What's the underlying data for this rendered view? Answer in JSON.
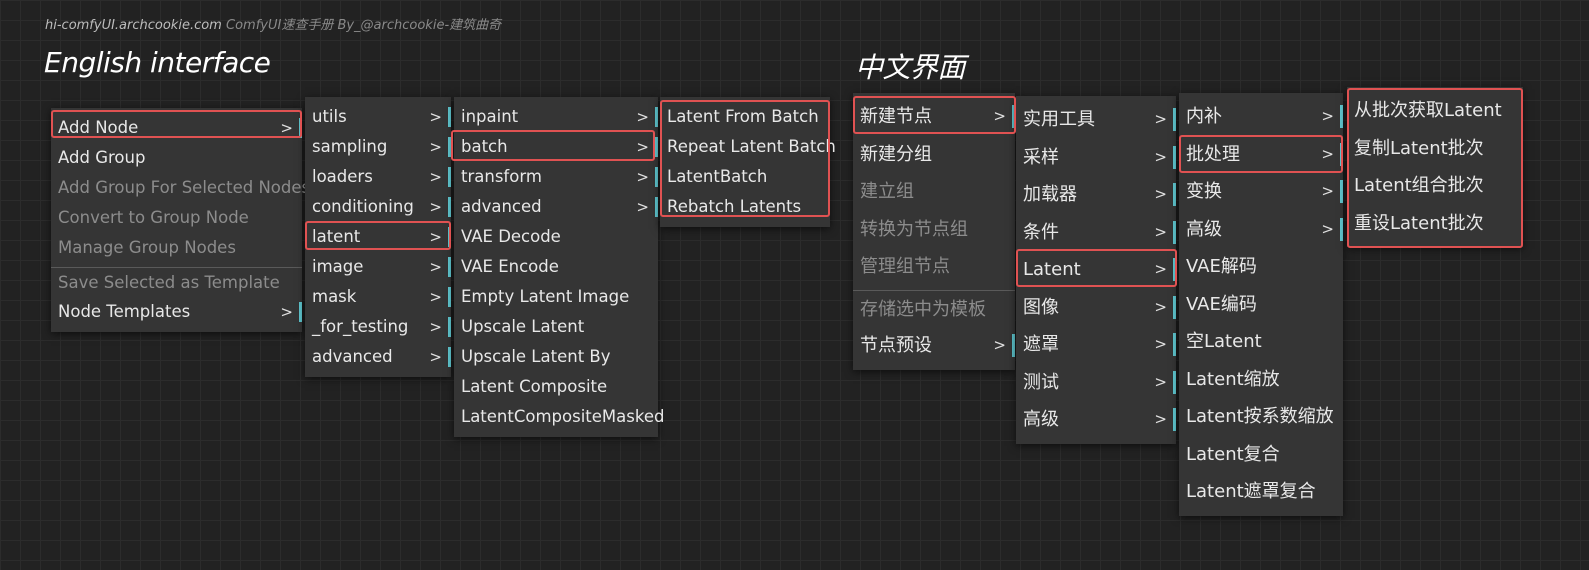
{
  "header": {
    "site": "hi-comfyUI.archcookie.com",
    "subtitle": "ComfyUI速查手册 By_@archcookie-建筑曲奇"
  },
  "english": {
    "title": "English interface",
    "main_menu": [
      {
        "label": "Add Node",
        "submenu": true,
        "disabled": false
      },
      {
        "label": "Add Group",
        "submenu": false,
        "disabled": false
      },
      {
        "label": "Add Group For Selected Nodes",
        "submenu": false,
        "disabled": true
      },
      {
        "label": "Convert to Group Node",
        "submenu": false,
        "disabled": true
      },
      {
        "label": "Manage Group Nodes",
        "submenu": false,
        "disabled": true
      },
      {
        "label": "Save Selected as Template",
        "submenu": false,
        "disabled": true
      },
      {
        "label": "Node Templates",
        "submenu": true,
        "disabled": false
      }
    ],
    "categories": [
      "utils",
      "sampling",
      "loaders",
      "conditioning",
      "latent",
      "image",
      "mask",
      "_for_testing",
      "advanced"
    ],
    "latent_menu": [
      {
        "label": "inpaint",
        "submenu": true
      },
      {
        "label": "batch",
        "submenu": true
      },
      {
        "label": "transform",
        "submenu": true
      },
      {
        "label": "advanced",
        "submenu": true
      },
      {
        "label": "VAE Decode",
        "submenu": false
      },
      {
        "label": "VAE Encode",
        "submenu": false
      },
      {
        "label": "Empty Latent Image",
        "submenu": false
      },
      {
        "label": "Upscale Latent",
        "submenu": false
      },
      {
        "label": "Upscale Latent By",
        "submenu": false
      },
      {
        "label": "Latent Composite",
        "submenu": false
      },
      {
        "label": "LatentCompositeMasked",
        "submenu": false
      }
    ],
    "batch_menu": [
      "Latent From Batch",
      "Repeat Latent Batch",
      "LatentBatch",
      "Rebatch Latents"
    ]
  },
  "chinese": {
    "title": "中文界面",
    "main_menu": [
      {
        "label": "新建节点",
        "submenu": true,
        "disabled": false
      },
      {
        "label": "新建分组",
        "submenu": false,
        "disabled": false
      },
      {
        "label": "建立组",
        "submenu": false,
        "disabled": true
      },
      {
        "label": "转换为节点组",
        "submenu": false,
        "disabled": true
      },
      {
        "label": "管理组节点",
        "submenu": false,
        "disabled": true
      },
      {
        "label": "存储选中为模板",
        "submenu": false,
        "disabled": true
      },
      {
        "label": "节点预设",
        "submenu": true,
        "disabled": false
      }
    ],
    "categories": [
      "实用工具",
      "采样",
      "加载器",
      "条件",
      "Latent",
      "图像",
      "遮罩",
      "测试",
      "高级"
    ],
    "latent_menu": [
      {
        "label": "内补",
        "submenu": true
      },
      {
        "label": "批处理",
        "submenu": true
      },
      {
        "label": "变换",
        "submenu": true
      },
      {
        "label": "高级",
        "submenu": true
      },
      {
        "label": "VAE解码",
        "submenu": false
      },
      {
        "label": "VAE编码",
        "submenu": false
      },
      {
        "label": "空Latent",
        "submenu": false
      },
      {
        "label": "Latent缩放",
        "submenu": false
      },
      {
        "label": "Latent按系数缩放",
        "submenu": false
      },
      {
        "label": "Latent复合",
        "submenu": false
      },
      {
        "label": "Latent遮罩复合",
        "submenu": false
      }
    ],
    "batch_menu": [
      "从批次获取Latent",
      "复制Latent批次",
      "Latent组合批次",
      "重设Latent批次"
    ]
  },
  "colors": {
    "highlight": "#e05252",
    "submenu_bar": "#5fc7cf",
    "menu_bg": "#353535"
  }
}
